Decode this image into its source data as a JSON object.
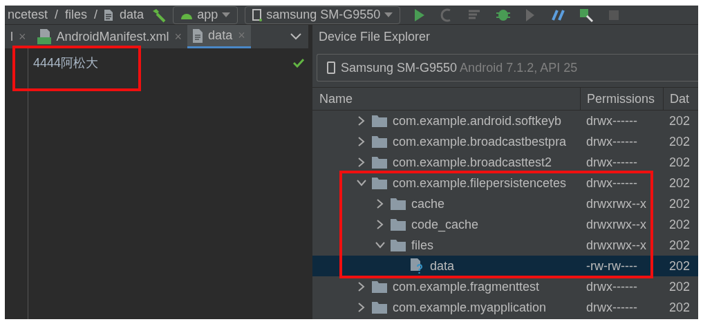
{
  "toolbar": {
    "breadcrumb": [
      "ncetest",
      "/",
      "files",
      "/",
      "data"
    ],
    "module_dropdown": {
      "label": "app"
    },
    "device_dropdown": {
      "label": "samsung SM-G9550"
    }
  },
  "editor": {
    "tabs": [
      {
        "label": "l",
        "close": "×",
        "kind": "plain",
        "selected": false
      },
      {
        "label": "AndroidManifest.xml",
        "close": "×",
        "kind": "manifest",
        "selected": false
      },
      {
        "label": "data",
        "close": "×",
        "kind": "document",
        "selected": true
      }
    ],
    "lines": [
      "4444阿松大"
    ],
    "highlighted": true
  },
  "device_file_explorer": {
    "title": "Device File Explorer",
    "device": {
      "name": "Samsung SM-G9550",
      "detail": "Android 7.1.2, API 25"
    },
    "columns": [
      "Name",
      "Permissions",
      "Dat"
    ],
    "tree": [
      {
        "kind": "folder",
        "name": "com.example.android.softkeyb",
        "permissions": "drwx------",
        "date": "202",
        "expanded": false,
        "selected": false,
        "highlighted": false
      },
      {
        "kind": "folder",
        "name": "com.example.broadcastbestpra",
        "permissions": "drwx------",
        "date": "202",
        "expanded": false,
        "selected": false,
        "highlighted": false
      },
      {
        "kind": "folder",
        "name": "com.example.broadcasttest2",
        "permissions": "drwx------",
        "date": "202",
        "expanded": false,
        "selected": false,
        "highlighted": false
      },
      {
        "kind": "folder",
        "name": "com.example.filepersistencetes",
        "permissions": "drwx------",
        "date": "202",
        "expanded": true,
        "selected": false,
        "highlighted": true,
        "children": [
          {
            "kind": "folder",
            "name": "cache",
            "permissions": "drwxrwx--x",
            "date": "202",
            "expanded": false,
            "selected": false,
            "highlighted": false
          },
          {
            "kind": "folder",
            "name": "code_cache",
            "permissions": "drwxrwx--x",
            "date": "202",
            "expanded": false,
            "selected": false,
            "highlighted": false
          },
          {
            "kind": "folder",
            "name": "files",
            "permissions": "drwxrwx--x",
            "date": "202",
            "expanded": true,
            "selected": false,
            "highlighted": false,
            "children": [
              {
                "kind": "file",
                "name": "data",
                "permissions": "-rw-rw----",
                "date": "202",
                "selected": true,
                "highlighted": false
              }
            ]
          }
        ]
      },
      {
        "kind": "folder",
        "name": "com.example.fragmenttest",
        "permissions": "drwx------",
        "date": "202",
        "expanded": false,
        "selected": false,
        "highlighted": false
      },
      {
        "kind": "folder",
        "name": "com.example.myapplication",
        "permissions": "drwx------",
        "date": "202",
        "expanded": false,
        "selected": false,
        "highlighted": false
      }
    ]
  }
}
